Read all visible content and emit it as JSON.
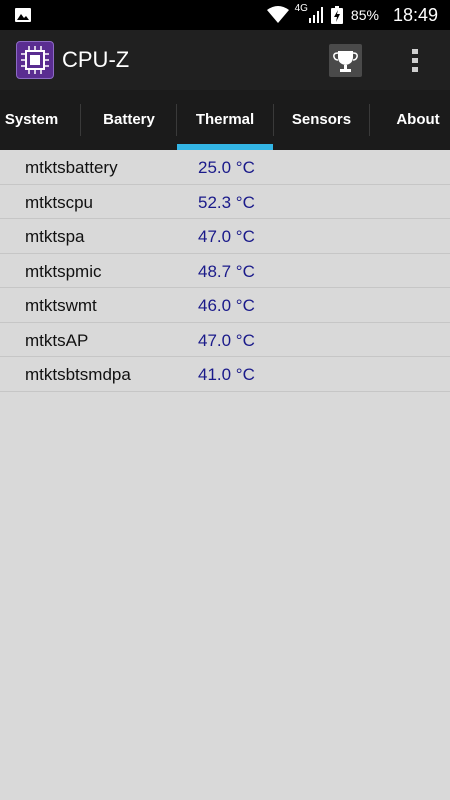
{
  "status_bar": {
    "network": "4G",
    "battery_percent": "85%",
    "time": "18:49",
    "icons": [
      "image-icon",
      "wifi-icon",
      "signal-icon",
      "battery-charging-icon"
    ]
  },
  "app_bar": {
    "title": "CPU-Z",
    "icons": [
      "cpu-logo-icon",
      "trophy-icon",
      "more-vert-icon"
    ]
  },
  "tabs": [
    {
      "label": "System"
    },
    {
      "label": "Battery"
    },
    {
      "label": "Thermal",
      "selected": true
    },
    {
      "label": "Sensors"
    },
    {
      "label": "About"
    }
  ],
  "colors": {
    "accent": "#33b5e5",
    "value_text": "#1a1a8a",
    "background": "#d9d9d9"
  },
  "thermal": [
    {
      "name": "mtktsbattery",
      "value": "25.0 °C"
    },
    {
      "name": "mtktscpu",
      "value": "52.3 °C"
    },
    {
      "name": "mtktspa",
      "value": "47.0 °C"
    },
    {
      "name": "mtktspmic",
      "value": "48.7 °C"
    },
    {
      "name": "mtktswmt",
      "value": "46.0 °C"
    },
    {
      "name": "mtktsAP",
      "value": "47.0 °C"
    },
    {
      "name": "mtktsbtsmdpa",
      "value": "41.0 °C"
    }
  ]
}
